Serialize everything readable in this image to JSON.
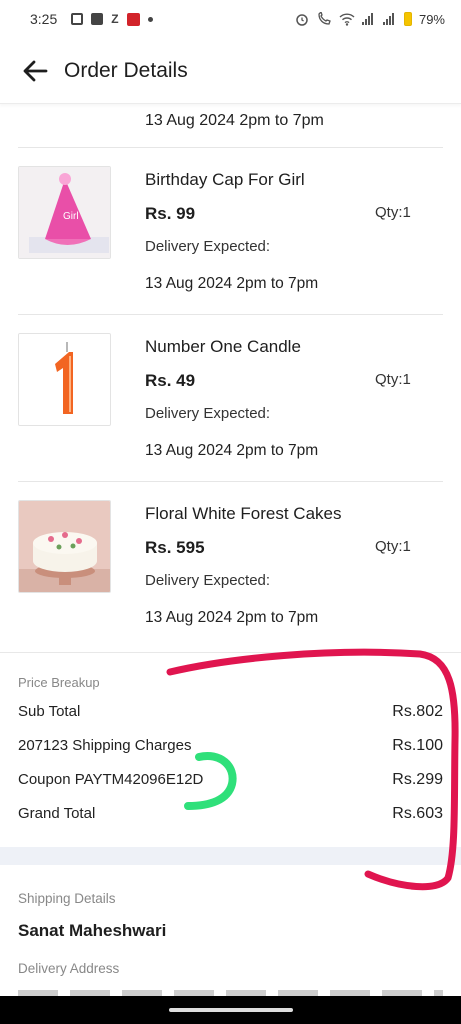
{
  "status_bar": {
    "time": "3:25",
    "battery": "79%",
    "icons_left": [
      "instagram-icon",
      "picture-icon",
      "z-icon",
      "flipboard-icon",
      "dot-icon"
    ],
    "icons_right": [
      "alarm-icon",
      "volte-icon",
      "wifi-icon",
      "signal-icon",
      "signal-icon",
      "battery-icon"
    ],
    "z_label": "Z"
  },
  "header": {
    "title": "Order Details",
    "back_icon": "back-arrow-icon"
  },
  "first_item_delivery_date": "13 Aug 2024 2pm to 7pm",
  "items": [
    {
      "name": "Birthday Cap For Girl",
      "price": "Rs. 99",
      "qty": "Qty:1",
      "delivery_label": "Delivery Expected:",
      "delivery_date": "13 Aug 2024 2pm to 7pm",
      "image": "pink-birthday-cap-image"
    },
    {
      "name": "Number One Candle",
      "price": "Rs. 49",
      "qty": "Qty:1",
      "delivery_label": "Delivery Expected:",
      "delivery_date": "13 Aug 2024 2pm to 7pm",
      "image": "orange-number-one-candle-image"
    },
    {
      "name": "Floral White Forest Cakes",
      "price": "Rs. 595",
      "qty": "Qty:1",
      "delivery_label": "Delivery Expected:",
      "delivery_date": "13 Aug 2024 2pm to 7pm",
      "image": "floral-white-cake-image"
    }
  ],
  "price_breakup": {
    "heading": "Price Breakup",
    "rows": [
      {
        "label": "Sub Total",
        "value": "Rs.802"
      },
      {
        "label": "207123 Shipping Charges",
        "value": "Rs.100"
      },
      {
        "label": "Coupon PAYTM42096E12D",
        "value": "Rs.299"
      },
      {
        "label": "Grand Total",
        "value": "Rs.603"
      }
    ]
  },
  "shipping": {
    "heading": "Shipping Details",
    "name": "Sanat Maheshwari",
    "address_heading": "Delivery Address"
  },
  "colors": {
    "annotation_red": "#e0154f",
    "annotation_green": "#2fe07a",
    "section_band": "#eef1f7",
    "candle_orange": "#f26522",
    "cap_pink": "#e94fa8"
  }
}
